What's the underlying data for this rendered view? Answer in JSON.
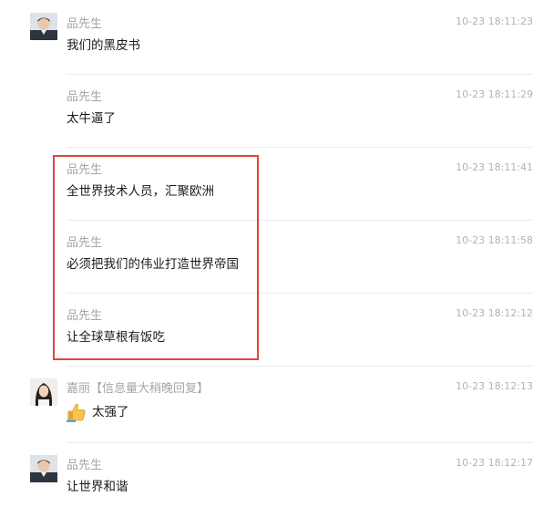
{
  "messages": [
    {
      "sender": "品先生",
      "time": "10-23 18:11:23",
      "text": "我们的黑皮书"
    },
    {
      "sender": "品先生",
      "time": "10-23 18:11:29",
      "text": "太牛逼了"
    },
    {
      "sender": "品先生",
      "time": "10-23 18:11:41",
      "text": "全世界技术人员，汇聚欧洲"
    },
    {
      "sender": "品先生",
      "time": "10-23 18:11:58",
      "text": "必须把我们的伟业打造世界帝国"
    },
    {
      "sender": "品先生",
      "time": "10-23 18:12:12",
      "text": "让全球草根有饭吃"
    },
    {
      "sender": "嘉丽【信息量大稍晚回复】",
      "time": "10-23 18:12:13",
      "text": "太强了",
      "emoji": "thumbs-up-icon"
    },
    {
      "sender": "品先生",
      "time": "10-23 18:12:17",
      "text": "让世界和谐"
    }
  ],
  "colors": {
    "highlight_border": "#e0463c",
    "sender_text": "#a6a6a6",
    "time_text": "#b3b3b3",
    "message_text": "#1a1a1a",
    "separator": "#ececec"
  }
}
